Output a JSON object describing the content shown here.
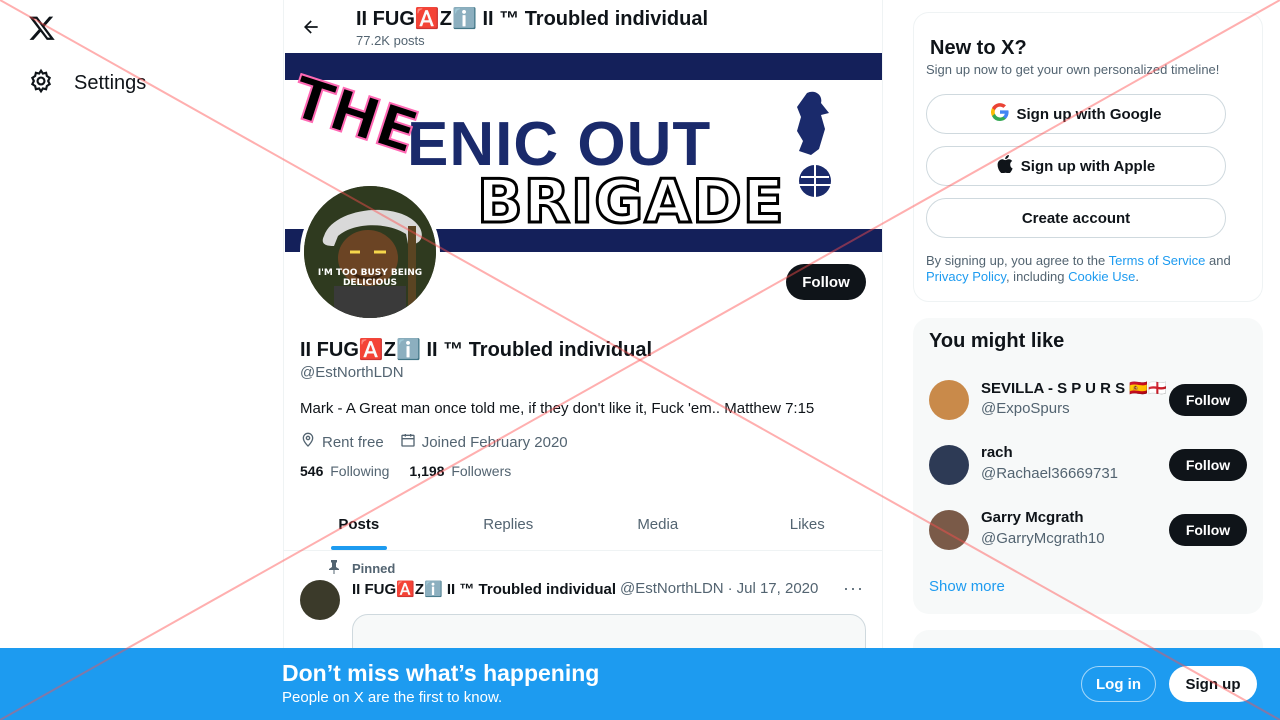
{
  "nav": {
    "settings_label": "Settings"
  },
  "header": {
    "name": "II FUG🅰️Zℹ️ II ™ Troubled individual",
    "posts_count": "77.2K posts"
  },
  "banner": {
    "word_the": "THE",
    "word_enic": "ENIC OUT",
    "word_brigade": "BRIGADE"
  },
  "avatar": {
    "caption": "I'M TOO BUSY BEING DELICIOUS"
  },
  "profile": {
    "follow_label": "Follow",
    "name": "II FUG🅰️Zℹ️ II ™ Troubled individual",
    "handle": "@EstNorthLDN",
    "bio": "Mark - A Great man once told me, if they don't like it, Fuck 'em.. Matthew 7:15",
    "location": "Rent free",
    "joined": "Joined February 2020",
    "following_count": "546",
    "following_label": "Following",
    "followers_count": "1,198",
    "followers_label": "Followers"
  },
  "tabs": [
    {
      "label": "Posts",
      "active": true
    },
    {
      "label": "Replies"
    },
    {
      "label": "Media"
    },
    {
      "label": "Likes"
    }
  ],
  "post": {
    "pinned_label": "Pinned",
    "author": "II FUG🅰️Zℹ️ II ™ Troubled individual",
    "handle": "@EstNorthLDN",
    "separator": "·",
    "date": "Jul 17, 2020",
    "more": "···"
  },
  "signup": {
    "title": "New to X?",
    "subtitle": "Sign up now to get your own personalized timeline!",
    "google": "Sign up with Google",
    "apple": "Sign up with Apple",
    "create": "Create account",
    "legal_1": "By signing up, you agree to the ",
    "terms": "Terms of Service",
    "legal_2": " and ",
    "privacy": "Privacy Policy",
    "legal_3": ", including ",
    "cookie": "Cookie Use",
    "legal_4": "."
  },
  "suggestions": {
    "title": "You might like",
    "items": [
      {
        "name": "SEVILLA - S P U R S 🇪🇸🏴󠁧󠁢󠁥󠁮󠁧󠁿",
        "handle": "@ExpoSpurs",
        "button": "Follow"
      },
      {
        "name": "rach",
        "handle": "@Rachael36669731",
        "button": "Follow"
      },
      {
        "name": "Garry Mcgrath",
        "handle": "@GarryMcgrath10",
        "button": "Follow"
      }
    ],
    "show_more": "Show more"
  },
  "bottom_bar": {
    "title": "Don’t miss what’s happening",
    "subtitle": "People on X are the first to know.",
    "login": "Log in",
    "signup": "Sign up"
  }
}
